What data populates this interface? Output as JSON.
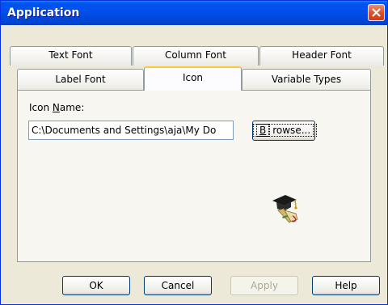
{
  "window": {
    "title": "Application",
    "close_glyph": "✕"
  },
  "tabs_row1": [
    {
      "label": "Text Font"
    },
    {
      "label": "Column Font"
    },
    {
      "label": "Header Font"
    }
  ],
  "tabs_row2": [
    {
      "label": "Label Font"
    },
    {
      "label": "Icon",
      "active": true
    },
    {
      "label": "Variable Types"
    }
  ],
  "icon_panel": {
    "label_prefix": "Icon ",
    "label_mnemonic": "N",
    "label_suffix": "ame:",
    "icon_name_value": "C:\\Documents and Settings\\aja\\My Do",
    "browse_mnemonic": "B",
    "browse_suffix": "rowse...",
    "preview_icon": "graduation-cap-diploma-icon"
  },
  "buttons": {
    "ok": "OK",
    "cancel": "Cancel",
    "apply": "Apply",
    "help": "Help"
  },
  "colors": {
    "title_bar": "#0053ee",
    "tab_highlight": "#ffc83c",
    "dialog_bg": "#ece9d8",
    "close_button": "#d8502c"
  }
}
